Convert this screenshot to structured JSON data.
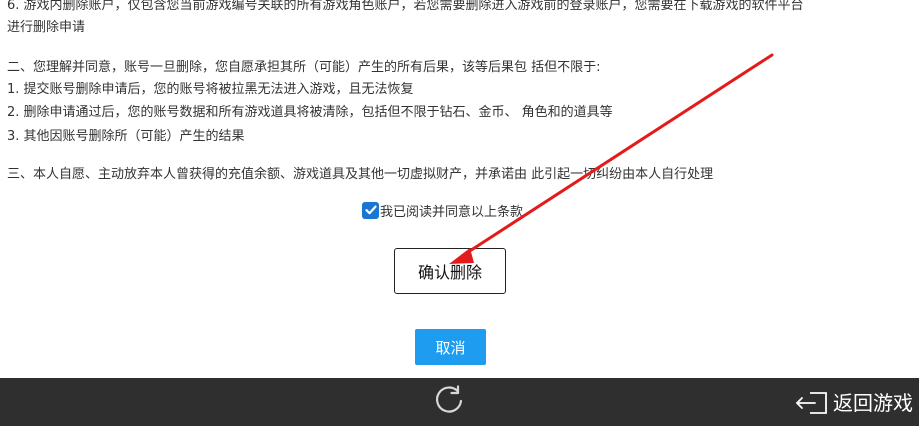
{
  "content": {
    "item6_line1": "6. 游戏内删除账户，仅包含您当前游戏编号关联的所有游戏角色账户，若您需要删除进入游戏前的登录账户，您需要在下载游戏的软件平台",
    "item6_line2": "进行删除申请",
    "section2_intro": "二、您理解并同意，账号一旦删除，您自愿承担其所（可能）产生的所有后果，该等后果包 括但不限于:",
    "section2_item1": "1. 提交账号删除申请后，您的账号将被拉黑无法进入游戏，且无法恢复",
    "section2_item2": "2. 删除申请通过后，您的账号数据和所有游戏道具将被清除，包括但不限于钻石、金币、 角色和的道具等",
    "section2_item3": "3. 其他因账号删除所（可能）产生的结果",
    "section3": "三、本人自愿、主动放弃本人曾获得的充值余额、游戏道具及其他一切虚拟财产，并承诺由 此引起一切纠纷由本人自行处理"
  },
  "agreement": {
    "checked": true,
    "label": "我已阅读并同意以上条款"
  },
  "buttons": {
    "confirm_label": "确认删除",
    "cancel_label": "取消"
  },
  "bottom_bar": {
    "refresh_icon": "refresh-icon",
    "back_icon": "back-arrow-icon",
    "back_label": "返回游戏"
  },
  "colors": {
    "checkbox": "#1976d2",
    "cancel_button": "#1e9cf0",
    "bottom_bar": "#2f2f2f",
    "annotation_arrow": "#e31b1b"
  }
}
